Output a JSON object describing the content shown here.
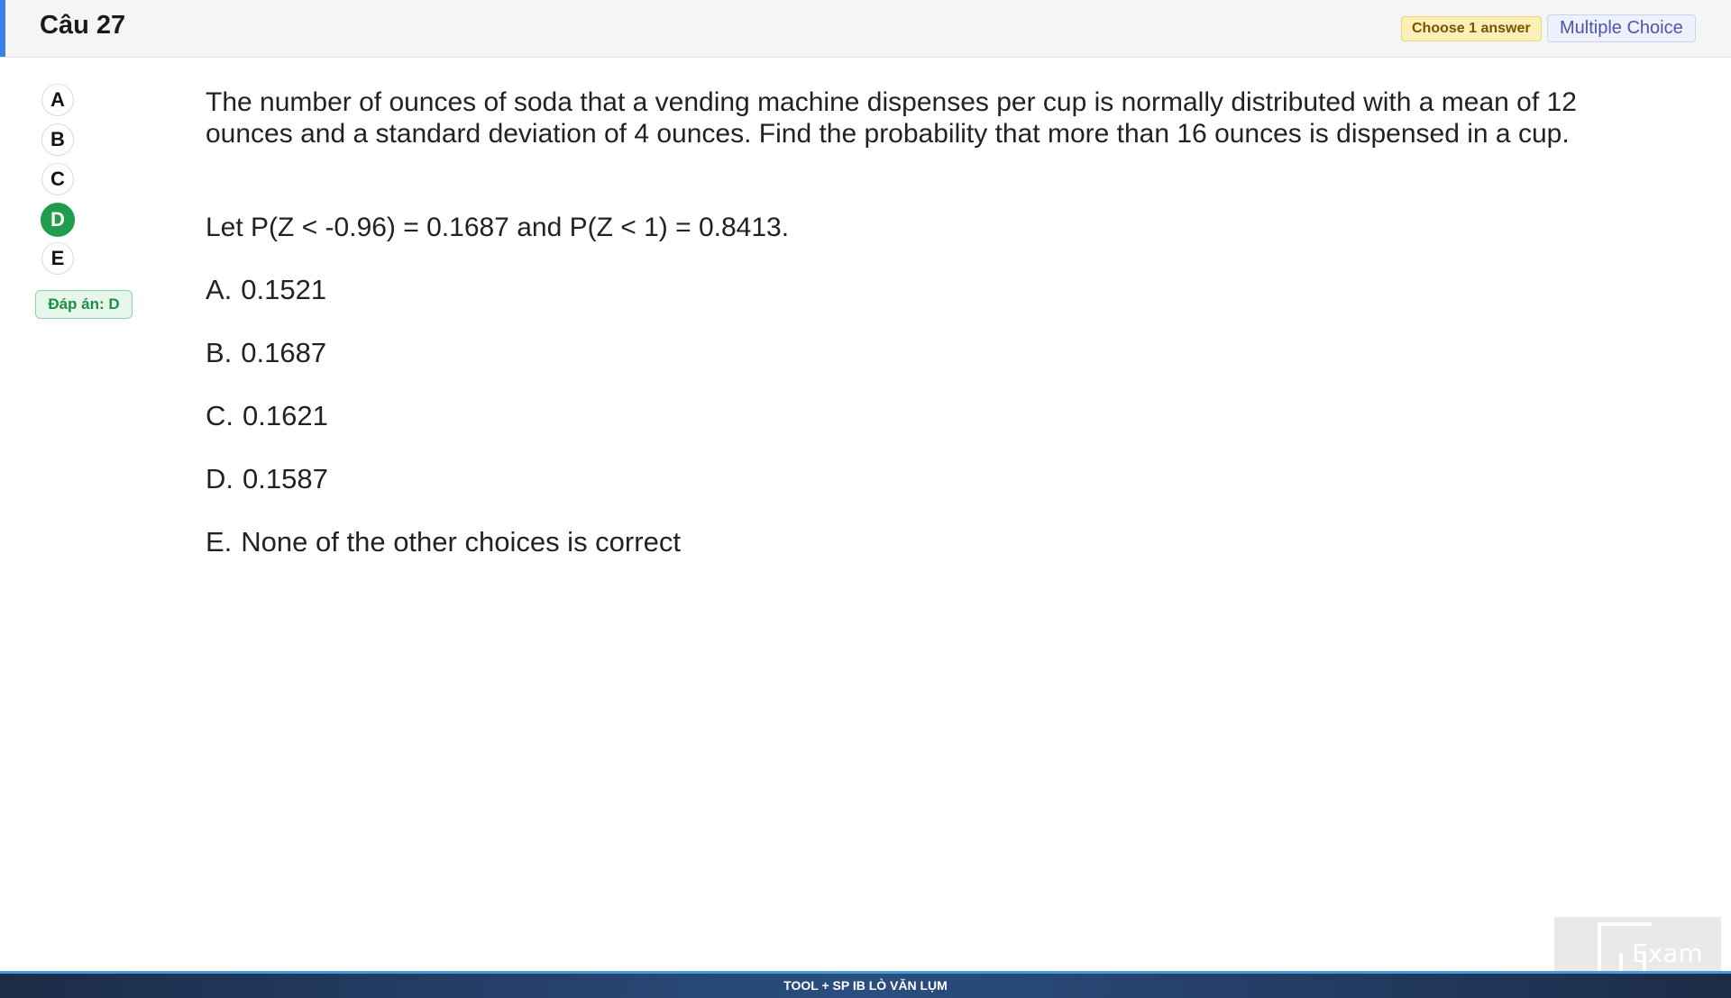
{
  "header": {
    "title": "Câu 27",
    "choose_badge": "Choose 1 answer",
    "type_badge": "Multiple Choice"
  },
  "selector": {
    "options": [
      "A",
      "B",
      "C",
      "D",
      "E"
    ],
    "selected": "D",
    "answer_label": "Đáp án: D"
  },
  "question": {
    "text": "The number of ounces of soda that a vending machine dispenses per cup is normally distributed with a mean of 12 ounces and a standard deviation of 4 ounces. Find the probability that more than 16 ounces is dispensed in a cup.",
    "hint": "Let P(Z < -0.96) = 0.1687 and P(Z < 1) = 0.8413."
  },
  "choices": [
    {
      "letter": "A.",
      "text": "0.1521"
    },
    {
      "letter": "B.",
      "text": "0.1687"
    },
    {
      "letter": "C.",
      "text": "0.1621"
    },
    {
      "letter": "D.",
      "text": "0.1587"
    },
    {
      "letter": "E.",
      "text": "None of the other choices is correct"
    }
  ],
  "footer": {
    "text": "TOOL + SP IB LÒ VĂN LỤM"
  },
  "logo": {
    "text": "Exam"
  },
  "colors": {
    "accent": "#3b82e6",
    "selected_green": "#1f9d4c",
    "footer_bg": "#1c2c48"
  }
}
